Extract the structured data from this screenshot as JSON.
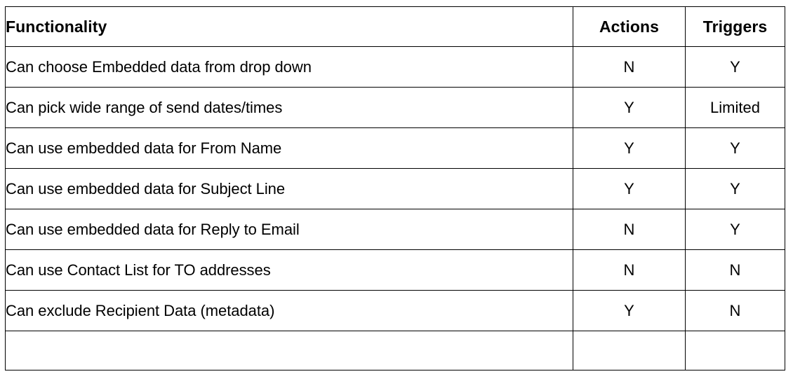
{
  "table": {
    "columns": [
      {
        "key": "functionality",
        "label": "Functionality",
        "align": "left"
      },
      {
        "key": "actions",
        "label": "Actions",
        "align": "center"
      },
      {
        "key": "triggers",
        "label": "Triggers",
        "align": "center"
      }
    ],
    "rows": [
      {
        "functionality": "Can choose Embedded data from drop down",
        "actions": "N",
        "triggers": "Y"
      },
      {
        "functionality": "Can pick wide range of send dates/times",
        "actions": "Y",
        "triggers": "Limited"
      },
      {
        "functionality": "Can use embedded data for From Name",
        "actions": "Y",
        "triggers": "Y"
      },
      {
        "functionality": "Can use embedded data for Subject Line",
        "actions": "Y",
        "triggers": "Y"
      },
      {
        "functionality": "Can use embedded data for Reply to Email",
        "actions": "N",
        "triggers": "Y"
      },
      {
        "functionality": "Can use Contact List for TO addresses",
        "actions": "N",
        "triggers": "N"
      },
      {
        "functionality": "Can exclude Recipient Data (metadata)",
        "actions": "Y",
        "triggers": "N"
      },
      {
        "functionality": "",
        "actions": "",
        "triggers": ""
      }
    ]
  },
  "colors": {
    "background": "#ffffff",
    "border": "#000000",
    "text": "#000000"
  }
}
